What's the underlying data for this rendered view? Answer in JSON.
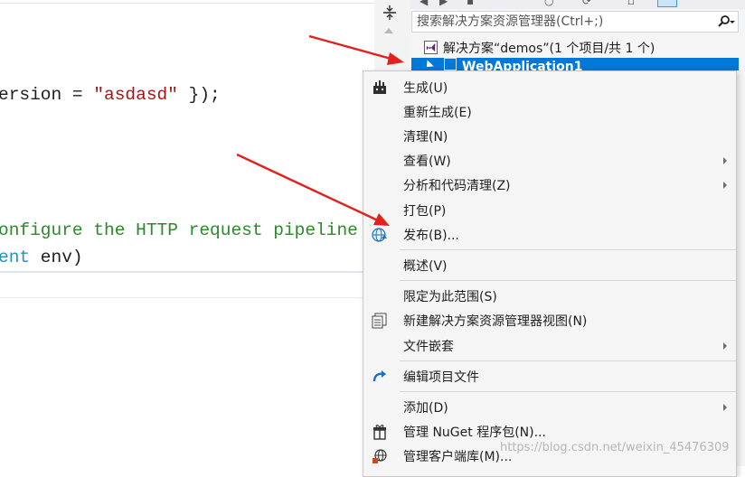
{
  "editor": {
    "line1_code": "ersion = ",
    "line1_string": "\"asdasd\"",
    "line1_tail": " });",
    "line2_comment": "onfigure the HTTP request pipeline",
    "line3_type": "ent",
    "line3_tail": " env)"
  },
  "explorer": {
    "search_placeholder": "搜索解决方案资源管理器(Ctrl+;)",
    "solution_label": "解决方案“demos”(1 个项目/共 1 个)",
    "project_label": "WebApplication1"
  },
  "context_menu": {
    "items": [
      {
        "label": "生成(U)",
        "icon": "build-icon",
        "submenu": false
      },
      {
        "label": "重新生成(E)",
        "icon": "",
        "submenu": false
      },
      {
        "label": "清理(N)",
        "icon": "",
        "submenu": false
      },
      {
        "label": "查看(W)",
        "icon": "",
        "submenu": true
      },
      {
        "label": "分析和代码清理(Z)",
        "icon": "",
        "submenu": true
      },
      {
        "label": "打包(P)",
        "icon": "",
        "submenu": false
      },
      {
        "label": "发布(B)...",
        "icon": "publish-globe-icon",
        "submenu": false
      },
      {
        "label": "概述(V)",
        "icon": "",
        "submenu": false
      },
      {
        "label": "限定为此范围(S)",
        "icon": "",
        "submenu": false
      },
      {
        "label": "新建解决方案资源管理器视图(N)",
        "icon": "new-view-icon",
        "submenu": false
      },
      {
        "label": "文件嵌套",
        "icon": "",
        "submenu": true
      },
      {
        "label": "编辑项目文件",
        "icon": "edit-redo-icon",
        "submenu": false
      },
      {
        "label": "添加(D)",
        "icon": "",
        "submenu": true
      },
      {
        "label": "管理 NuGet 程序包(N)...",
        "icon": "nuget-package-icon",
        "submenu": false
      },
      {
        "label": "管理客户端库(M)...",
        "icon": "client-library-globe-icon",
        "submenu": false
      }
    ]
  },
  "watermark": "https://blog.csdn.net/weixin_45476309",
  "colors": {
    "selection": "#0078d7",
    "annotation_arrow": "#e3201b",
    "string": "#a31515",
    "comment": "#2b8a2b",
    "type": "#2b91af"
  }
}
